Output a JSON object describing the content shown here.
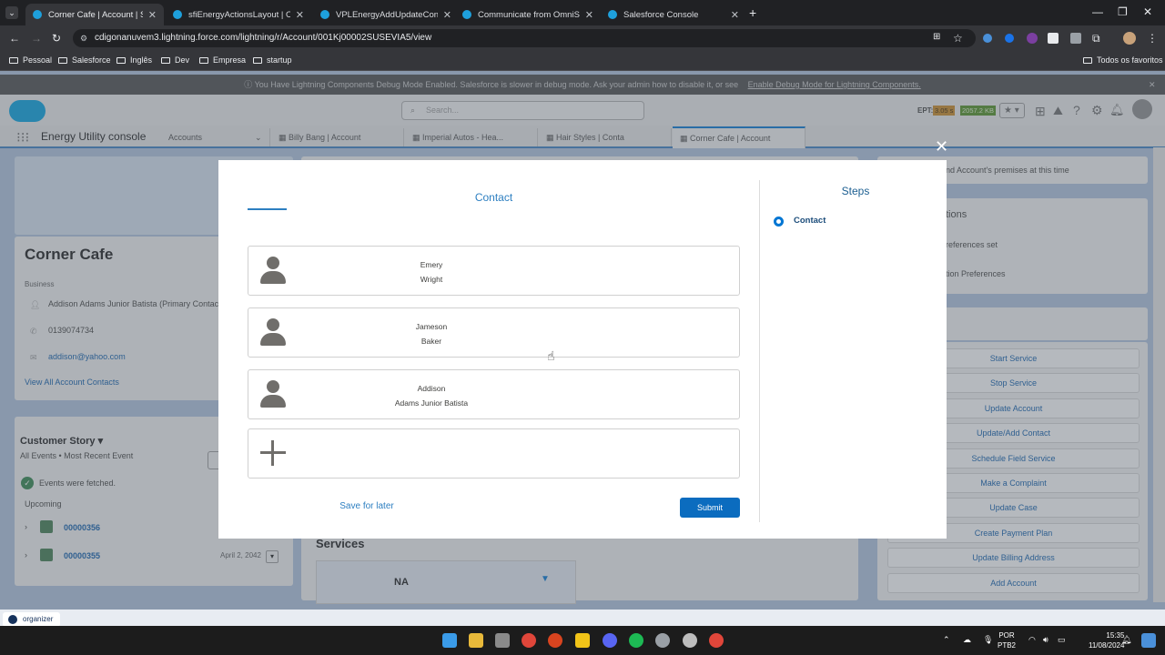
{
  "browser": {
    "tabs": [
      {
        "title": "Corner Cafe | Account | Salesfor"
      },
      {
        "title": "sfiEnergyActionsLayout | Omni"
      },
      {
        "title": "VPLEnergyAddUpdateContact |"
      },
      {
        "title": "Communicate from OmniScript"
      },
      {
        "title": "Salesforce Console"
      }
    ],
    "url": "cdigonanuvem3.lightning.force.com/lightning/r/Account/001Kj00002SUSEVIA5/view",
    "bookmarks": [
      "Pessoal",
      "Salesforce",
      "Inglês",
      "Dev",
      "Empresa",
      "startup"
    ],
    "all_bookmarks": "Todos os favoritos"
  },
  "debug_banner": {
    "text": "You Have Lightning Components Debug Mode Enabled. Salesforce is slower in debug mode. Ask your admin how to disable it, or see",
    "link": "Enable Debug Mode for Lightning Components."
  },
  "sf_header": {
    "search_placeholder": "Search...",
    "ept_label": "EPT:",
    "ept_value": "3.05 s",
    "mem_value": "2057.2 KB"
  },
  "nav": {
    "app_name": "Energy Utility console",
    "object_menu": "Accounts",
    "tabs": [
      "Billy Bang | Account",
      "Imperial Autos - Hea...",
      "Hair Styles | Conta",
      "Corner Cafe | Account"
    ]
  },
  "account": {
    "name": "Corner Cafe",
    "type": "Business",
    "primary_contact": "Addison Adams Junior Batista (Primary Contact)",
    "phone": "0139074734",
    "email": "addison@yahoo.com",
    "view_all": "View All Account Contacts"
  },
  "story": {
    "title": "Customer Story",
    "filter": "All Events • Most Recent Event",
    "fetched": "Events were fetched.",
    "upcoming": "Upcoming",
    "items": [
      {
        "id": "00000356",
        "date": ""
      },
      {
        "id": "00000355",
        "date": "April 2, 2042"
      }
    ]
  },
  "services": {
    "title": "Services",
    "value": "NA"
  },
  "right_panel": {
    "notice": "nd Account's premises at this time",
    "section": "tions",
    "pref1": "references set",
    "pref2": "tion Preferences",
    "actions": [
      "Start Service",
      "Stop Service",
      "Update Account",
      "Update/Add Contact",
      "Schedule Field Service",
      "Make a Complaint",
      "Update Case",
      "Create Payment Plan",
      "Update Billing Address",
      "Add Account"
    ]
  },
  "modal": {
    "title": "Contact",
    "contacts": [
      {
        "first": "Emery",
        "last": "Wright"
      },
      {
        "first": "Jameson",
        "last": "Baker"
      },
      {
        "first": "Addison",
        "last": "Adams Junior Batista"
      }
    ],
    "save_later": "Save for later",
    "submit": "Submit",
    "steps_title": "Steps",
    "steps": [
      "Contact"
    ]
  },
  "taskbar": {
    "organizer": "organizer",
    "lang1": "POR",
    "lang2": "PTB2",
    "time": "15:35",
    "date": "11/08/2024"
  }
}
